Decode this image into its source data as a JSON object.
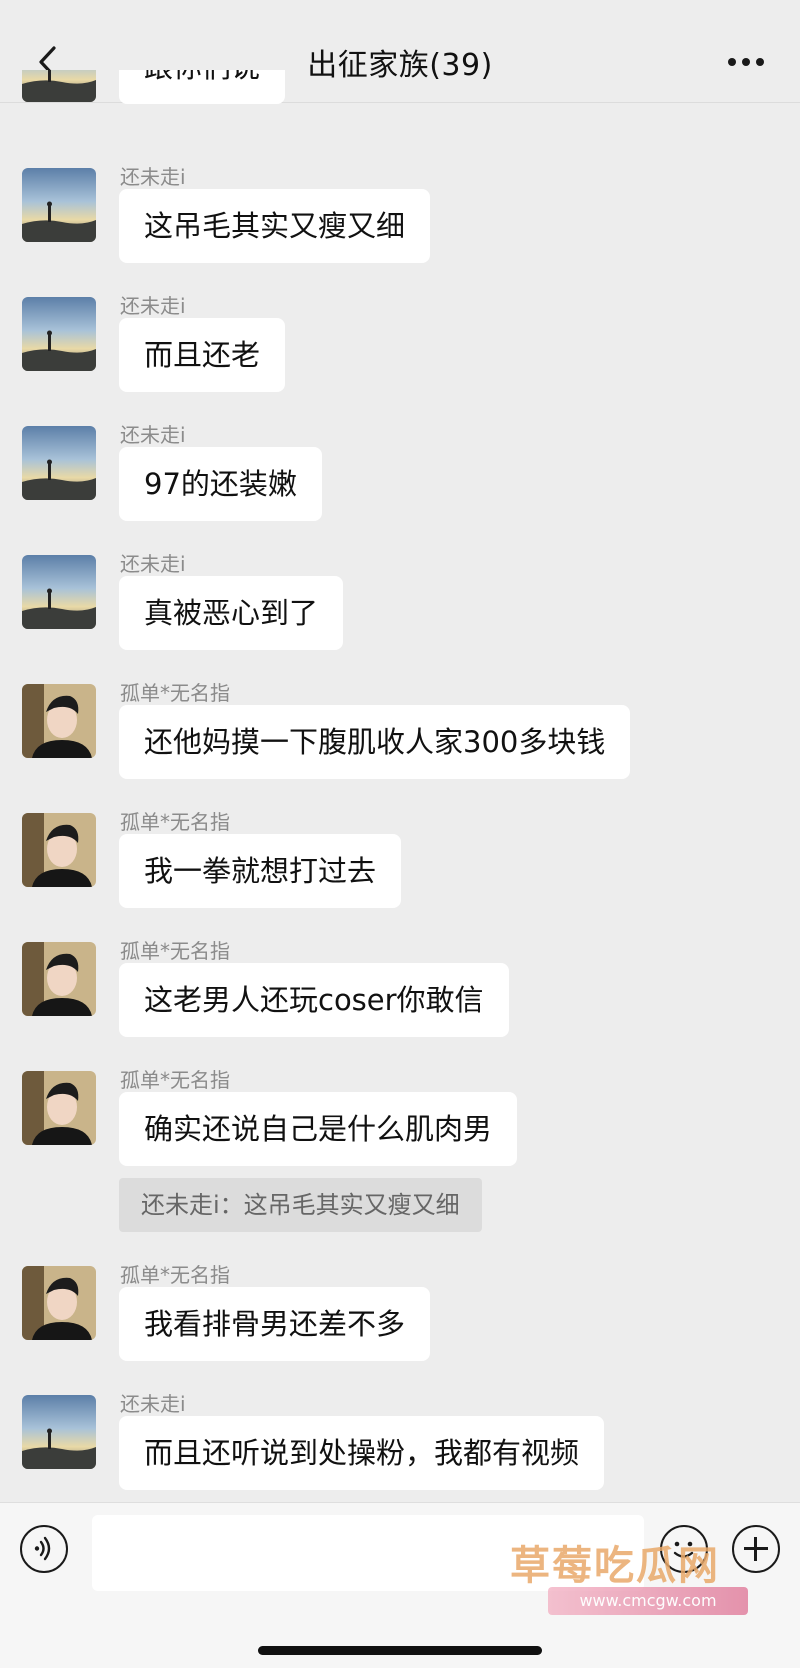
{
  "header": {
    "title": "出征家族(39)",
    "back_icon": "chevron-left-icon",
    "more_icon": "ellipsis-icon"
  },
  "messages": [
    {
      "avatar": "landscape-avatar",
      "sender": "",
      "text": "跟你们说"
    },
    {
      "avatar": "landscape-avatar",
      "sender": "还未走i",
      "text": "这吊毛其实又瘦又细"
    },
    {
      "avatar": "landscape-avatar",
      "sender": "还未走i",
      "text": "而且还老"
    },
    {
      "avatar": "landscape-avatar",
      "sender": "还未走i",
      "text": "97的还装嫩"
    },
    {
      "avatar": "landscape-avatar",
      "sender": "还未走i",
      "text": "真被恶心到了"
    },
    {
      "avatar": "person-avatar",
      "sender": "孤单*无名指",
      "text": "还他妈摸一下腹肌收人家300多块钱"
    },
    {
      "avatar": "person-avatar",
      "sender": "孤单*无名指",
      "text": "我一拳就想打过去"
    },
    {
      "avatar": "person-avatar",
      "sender": "孤单*无名指",
      "text": "这老男人还玩coser你敢信"
    },
    {
      "avatar": "person-avatar",
      "sender": "孤单*无名指",
      "text": "确实还说自己是什么肌肉男",
      "quote": "还未走i：这吊毛其实又瘦又细"
    },
    {
      "avatar": "person-avatar",
      "sender": "孤单*无名指",
      "text": "我看排骨男还差不多"
    },
    {
      "avatar": "landscape-avatar",
      "sender": "还未走i",
      "text": "而且还听说到处操粉，我都有视频"
    }
  ],
  "input_bar": {
    "voice_icon": "voice-icon",
    "text_value": "",
    "emoji_icon": "emoji-icon",
    "plus_icon": "plus-icon"
  },
  "watermark": {
    "text": "草莓吃瓜网",
    "url": "www.cmcgw.com"
  }
}
